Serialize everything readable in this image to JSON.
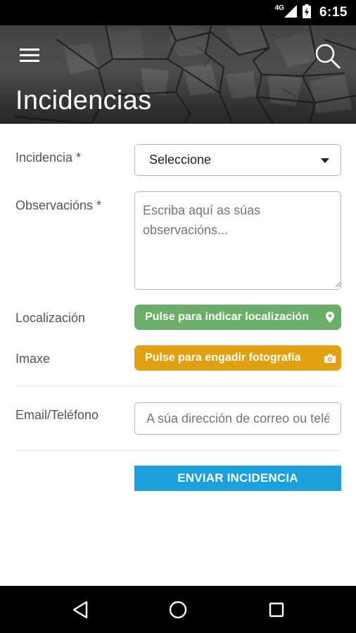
{
  "status_bar": {
    "network": "4G",
    "time": "6:15"
  },
  "header": {
    "title": "Incidencias",
    "menu_icon": "hamburger-menu-icon",
    "search_icon": "search-icon"
  },
  "form": {
    "incidencia": {
      "label": "Incidencia *",
      "selected": "Seleccione"
    },
    "observacions": {
      "label": "Observacións *",
      "placeholder": "Escriba aquí as súas observacións..."
    },
    "localizacion": {
      "label": "Localización",
      "button": "Pulse para indicar localización",
      "icon": "map-pin-icon"
    },
    "imaxe": {
      "label": "Imaxe",
      "button": "Pulse para engadir fotografía",
      "icon": "camera-icon"
    },
    "email": {
      "label": "Email/Teléfono",
      "placeholder": "A súa dirección de correo ou teléfono"
    },
    "submit": "ENVIAR INCIDENCIA"
  },
  "colors": {
    "location_button": "#6aae6a",
    "photo_button": "#e0a010",
    "submit_button": "#1aa0dc"
  },
  "nav_bar": {
    "back_icon": "back-triangle-icon",
    "home_icon": "home-circle-icon",
    "recents_icon": "recents-square-icon"
  }
}
